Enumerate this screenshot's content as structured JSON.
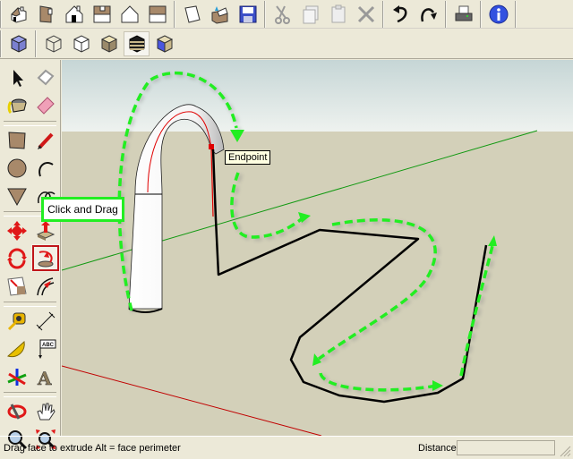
{
  "toolbar_top": {
    "views": [
      {
        "name": "iso-view",
        "label": "Iso"
      },
      {
        "name": "right-view",
        "label": "Right"
      },
      {
        "name": "front-view",
        "label": "Front"
      },
      {
        "name": "top-view",
        "label": "Top"
      },
      {
        "name": "back-view",
        "label": "Back"
      },
      {
        "name": "left-view",
        "label": "Left"
      }
    ],
    "file": [
      {
        "name": "new",
        "label": "New"
      },
      {
        "name": "open",
        "label": "Open"
      },
      {
        "name": "save",
        "label": "Save"
      }
    ],
    "edit": [
      {
        "name": "cut",
        "label": "Cut"
      },
      {
        "name": "copy",
        "label": "Copy"
      },
      {
        "name": "paste",
        "label": "Paste"
      },
      {
        "name": "erase",
        "label": "Erase"
      }
    ],
    "history": [
      {
        "name": "undo",
        "label": "Undo"
      },
      {
        "name": "redo",
        "label": "Redo"
      }
    ],
    "print_label": "Print",
    "info_label": "Model Info"
  },
  "toolbar_styles": {
    "items": [
      {
        "name": "xray",
        "label": "X-ray"
      },
      {
        "name": "wireframe",
        "label": "Wireframe"
      },
      {
        "name": "hidden-line",
        "label": "Hidden Line"
      },
      {
        "name": "shaded",
        "label": "Shaded"
      },
      {
        "name": "shaded-textures",
        "label": "Shaded With Textures",
        "pressed": true
      },
      {
        "name": "monochrome",
        "label": "Monochrome"
      }
    ]
  },
  "left_toolbar": {
    "tools": [
      "select",
      "make-component",
      "paint-bucket",
      "eraser",
      "rectangle",
      "line",
      "circle",
      "arc",
      "polygon",
      "freehand",
      "move",
      "push-pull",
      "rotate",
      "follow-me",
      "offset",
      "scale",
      "tape-measure",
      "dimension",
      "protractor",
      "text",
      "axes",
      "3d-text",
      "orbit",
      "pan",
      "zoom",
      "zoom-extents"
    ],
    "active_tool": "follow-me"
  },
  "viewport": {
    "endpoint_tooltip": "Endpoint",
    "callout": "Click and Drag",
    "colors": {
      "sky": "#e6ece9",
      "ground": "#d3d0b9",
      "guide_arrow": "#22ee22",
      "path": "#000000",
      "red_axis": "#c00000",
      "green_axis": "#119911"
    }
  },
  "statusbar": {
    "message": "Drag face to extrude  Alt = face perimeter",
    "distance_label": "Distance",
    "distance_value": ""
  }
}
